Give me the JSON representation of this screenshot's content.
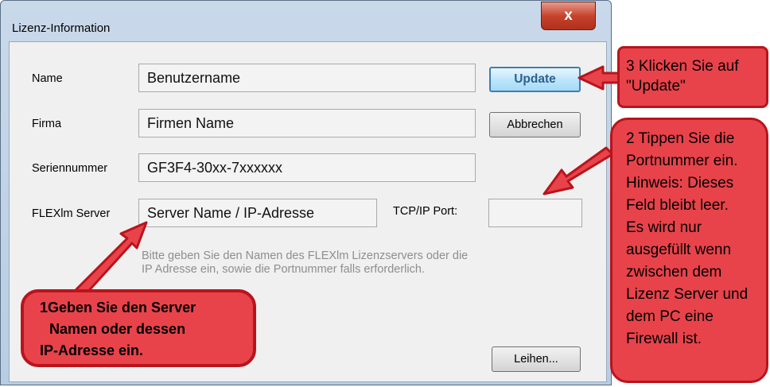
{
  "window": {
    "title": "Lizenz-Information",
    "close_glyph": "x"
  },
  "form": {
    "name_label": "Name",
    "name_value": "Benutzername",
    "firma_label": "Firma",
    "firma_value": "Firmen Name",
    "serial_label": "Seriennummer",
    "serial_value": "GF3F4-30xx-7xxxxxx",
    "server_label": "FLEXlm Server",
    "server_value": "Server Name / IP-Adresse",
    "port_label": "TCP/IP Port:",
    "port_value": "",
    "hint_line1": "Bitte geben Sie den Namen des FLEXlm Lizenzservers oder die",
    "hint_line2": "IP Adresse ein, sowie die Portnummer falls erforderlich."
  },
  "buttons": {
    "update": "Update",
    "cancel": "Abbrechen",
    "borrow": "Leihen..."
  },
  "annotations": {
    "step1_line1": "1Geben Sie den Server",
    "step1_line2": "Namen oder dessen",
    "step1_line3": "IP-Adresse ein.",
    "step2_lines": [
      "2 Tippen Sie die",
      "Portnummer ein.",
      "Hinweis: Dieses",
      "Feld bleibt leer.",
      "Es wird nur",
      "ausgefüllt wenn",
      "zwischen dem",
      "Lizenz Server und",
      "dem PC eine",
      "Firewall ist."
    ],
    "step3_line1": "3 Klicken Sie auf",
    "step3_line2": "\"Update\""
  },
  "colors": {
    "annotation_fill": "#e8434a",
    "annotation_border": "#b9141c",
    "update_border": "#3c7fb1"
  }
}
